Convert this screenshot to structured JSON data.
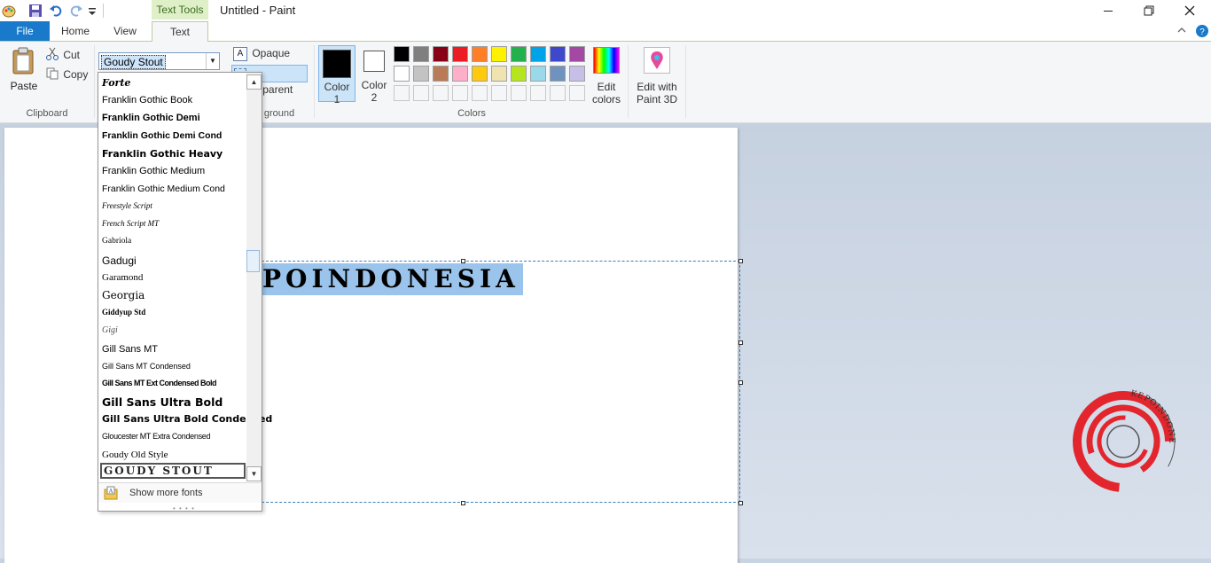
{
  "titlebar": {
    "context_tab": "Text Tools",
    "window_title": "Untitled - Paint",
    "qat_icons": [
      "paint-app-icon",
      "save-icon",
      "undo-icon",
      "redo-icon",
      "customize-qat-icon"
    ],
    "window_buttons": [
      "minimize",
      "maximize",
      "close"
    ]
  },
  "tabs": [
    {
      "label": "File",
      "active": false
    },
    {
      "label": "Home",
      "active": false
    },
    {
      "label": "View",
      "active": false
    },
    {
      "label": "Text",
      "active": true
    }
  ],
  "ribbon": {
    "clipboard": {
      "paste": "Paste",
      "cut": "Cut",
      "copy": "Copy",
      "group_label": "Clipboard"
    },
    "font": {
      "current": "Goudy Stout"
    },
    "background": {
      "opaque": "Opaque",
      "transparent": "Transparent",
      "group_label_visible": "ground"
    },
    "colors": {
      "color1": "Color",
      "color1_num": "1",
      "color2": "Color",
      "color2_num": "2",
      "color1_value": "#000000",
      "color2_value": "#ffffff",
      "palette_row1": [
        "#000000",
        "#7f7f7f",
        "#880015",
        "#ed1c24",
        "#ff7f27",
        "#fff200",
        "#22b14c",
        "#00a2e8",
        "#3f48cc",
        "#a349a4"
      ],
      "palette_row2": [
        "#ffffff",
        "#c3c3c3",
        "#b97a57",
        "#ffaec9",
        "#ffc90e",
        "#efe4b0",
        "#b5e61d",
        "#99d9ea",
        "#7092be",
        "#c8bfe7"
      ],
      "edit_colors_line1": "Edit",
      "edit_colors_line2": "colors",
      "group_label": "Colors"
    },
    "paint3d": {
      "line1": "Edit with",
      "line2": "Paint 3D"
    }
  },
  "dropdown": {
    "fonts": [
      "Forte",
      "Franklin Gothic Book",
      "Franklin Gothic Demi",
      "Franklin Gothic Demi Cond",
      "Franklin Gothic Heavy",
      "Franklin Gothic Medium",
      "Franklin Gothic Medium Cond",
      "Freestyle Script",
      "French Script MT",
      "Gabriola",
      "Gadugi",
      "Garamond",
      "Georgia",
      "Giddyup Std",
      "Gigi",
      "Gill Sans MT",
      "Gill Sans MT Condensed",
      "Gill Sans MT Ext Condensed Bold",
      "Gill Sans Ultra Bold",
      "Gill Sans Ultra Bold Condensed",
      "Gloucester MT Extra Condensed",
      "Goudy Old Style"
    ],
    "selected": "GOUDY STOUT",
    "show_more": "Show more fonts"
  },
  "canvas": {
    "text": "POINDONESIA"
  },
  "logo": {
    "arc_text": "KEPOINDONESIA",
    "accent": "#e3262d"
  }
}
